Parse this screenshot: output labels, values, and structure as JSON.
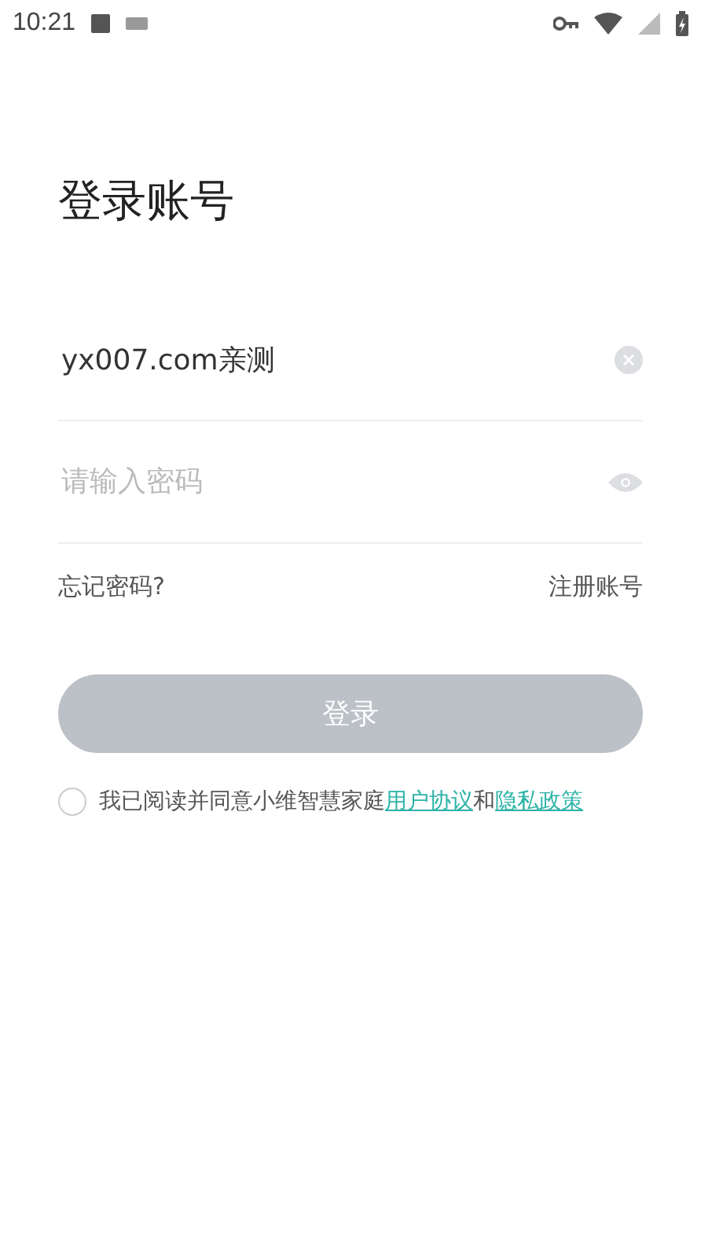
{
  "status_bar": {
    "time": "10:21"
  },
  "title": "登录账号",
  "account_field": {
    "value": "yx007.com亲测"
  },
  "password_field": {
    "placeholder": "请输入密码",
    "visible": false
  },
  "links": [
    "忘记密码?",
    "注册账号"
  ],
  "login_button": {
    "label": "登录",
    "disabled": true
  },
  "agreement": {
    "checked": false,
    "parts": [
      {
        "kind": "text",
        "text": "我已阅读并同意小维智慧家庭"
      },
      {
        "kind": "link",
        "text": "用户协议"
      },
      {
        "kind": "text",
        "text": "和"
      },
      {
        "kind": "link",
        "text": "隐私政策"
      }
    ]
  }
}
